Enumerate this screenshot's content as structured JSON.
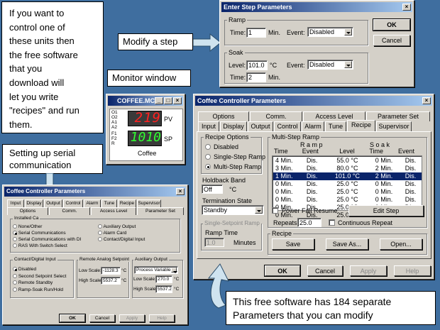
{
  "left_note": {
    "lines": [
      "If you want to",
      "control one of",
      "these units then",
      "the free software",
      "that you",
      "download will",
      "let you write",
      "\"recipes\" and run",
      "them."
    ]
  },
  "serial_note": {
    "lines": [
      "Setting up serial",
      "communication"
    ]
  },
  "modify_note": {
    "text": "Modify a step"
  },
  "monitor_note": {
    "text": "Monitor window"
  },
  "bottom_note": {
    "lines": [
      "This free software has 184 separate",
      "Parameters that you can modify"
    ]
  },
  "step_dialog": {
    "title": "Enter Step Parameters",
    "close": "×",
    "ramp_group": "Ramp",
    "time_label": "Time:",
    "time_value": "1",
    "min_label": "Min.",
    "event_label": "Event:",
    "event_value": "Disabled",
    "soak_group": "Soak",
    "level_label": "Level:",
    "level_value": "101.0",
    "level_unit": "°C",
    "soak_event_value": "Disabled",
    "soak_time_value": "2",
    "ok": "OK",
    "cancel": "Cancel"
  },
  "monitor": {
    "title": "COFFEE.MCS",
    "min": "_",
    "max": "□",
    "close": "×",
    "led_labels_top": [
      "O1",
      "O2",
      "A1",
      "A2"
    ],
    "led_labels_bot": [
      "F1",
      "F2",
      "R"
    ],
    "pv_value": "219",
    "pv_label": "PV",
    "sp_value": "1010",
    "sp_label": "SP",
    "name": "Coffee"
  },
  "main_dialog": {
    "title": "Coffee   Controller Parameters",
    "close": "×",
    "tabs_top": [
      "Options",
      "Comm.",
      "Access Level",
      "Parameter Set"
    ],
    "tabs_bottom": [
      "Input",
      "Display",
      "Output",
      "Control",
      "Alarm",
      "Tune",
      "Recipe",
      "Supervisor"
    ],
    "recipe_options_label": "Recipe Options",
    "options": [
      "Disabled",
      "Single-Step Ramp",
      "Multi-Step Ramp"
    ],
    "selected_option": 2,
    "holdback_label": "Holdback Band",
    "holdback_value": "Off",
    "holdback_unit": "°C",
    "termination_label": "Termination State",
    "termination_value": "Standby",
    "single_group": "Single-Setpoint Ramp",
    "ramp_time_label": "Ramp Time",
    "ramp_time_value": "1.0",
    "minutes_label": "Minutes",
    "multi_group": "Multi-Step Ramp",
    "ramp_header": "R a m p",
    "soak_header": "S o a k",
    "cols": [
      "Time",
      "Event",
      "Level",
      "Time",
      "Event"
    ],
    "rows": [
      [
        "4 Min.",
        "Dis.",
        "55.0 °C",
        "0 Min.",
        "Dis."
      ],
      [
        "3 Min.",
        "Dis.",
        "80.0 °C",
        "2 Min.",
        "Dis."
      ],
      [
        "1 Min.",
        "Dis.",
        "101.0 °C",
        "2 Min.",
        "Dis."
      ],
      [
        "0 Min.",
        "Dis.",
        "25.0 °C",
        "0 Min.",
        "Dis."
      ],
      [
        "0 Min.",
        "Dis.",
        "25.0 °C",
        "0 Min.",
        "Dis."
      ],
      [
        "0 Min.",
        "Dis.",
        "25.0 °C",
        "0 Min.",
        "Dis."
      ],
      [
        "0 Min.",
        "Dis.",
        "25.0 °C",
        "0 Min.",
        "Dis."
      ],
      [
        "0 Min.",
        "Dis.",
        "25.0 °C",
        "0 Min.",
        "Dis."
      ]
    ],
    "selected_row": 2,
    "power_fail": "Power Fail Resume",
    "edit_step": "Edit Step",
    "repeats_label": "Repeats",
    "repeats_value": "25.0",
    "continuous": "Continuous Repeat",
    "recipe_group": "Recipe",
    "save": "Save",
    "save_as": "Save As...",
    "open": "Open...",
    "ok": "OK",
    "cancel": "Cancel",
    "apply": "Apply",
    "help": "Help"
  },
  "comm_dialog": {
    "title": "Coffee   Controller Parameters",
    "close": "×",
    "tabs_top": [
      "Input",
      "Display",
      "Output",
      "Control",
      "Alarm",
      "Tune",
      "Recipe",
      "Supervisor"
    ],
    "tabs_bottom": [
      "Options",
      "Comm.",
      "Access Level",
      "Parameter Set"
    ],
    "installed_label": "Installed Ca",
    "left_options": [
      "None/Other",
      "Serial Communications",
      "Serial Communications with DI",
      "RAS With Switch Select"
    ],
    "left_selected": 1,
    "right_options": [
      "Auxiliary Output",
      "Alarm Card",
      "Contact/Digital Input"
    ],
    "contact_label": "Contact/Digital Input",
    "contact_options": [
      "Disabled",
      "Second Setpoint Select",
      "Remote Standby",
      "Ramp-Soak Run/Hold"
    ],
    "contact_selected": 0,
    "remote_label": "Remote Analog Setpoint",
    "low_scale_label": "Low Scale:",
    "low_scale_value": "-1128.3",
    "high_scale_label": "High Scale:",
    "high_scale_value": "5537.2",
    "unit": "°C",
    "aux_label": "Auxiliary Output",
    "aux_select": "Process Variable",
    "aux_low_value": "270.0",
    "aux_high_value": "5537.2",
    "ok": "OK",
    "cancel": "Cancel",
    "apply": "Apply",
    "help": "Help"
  }
}
